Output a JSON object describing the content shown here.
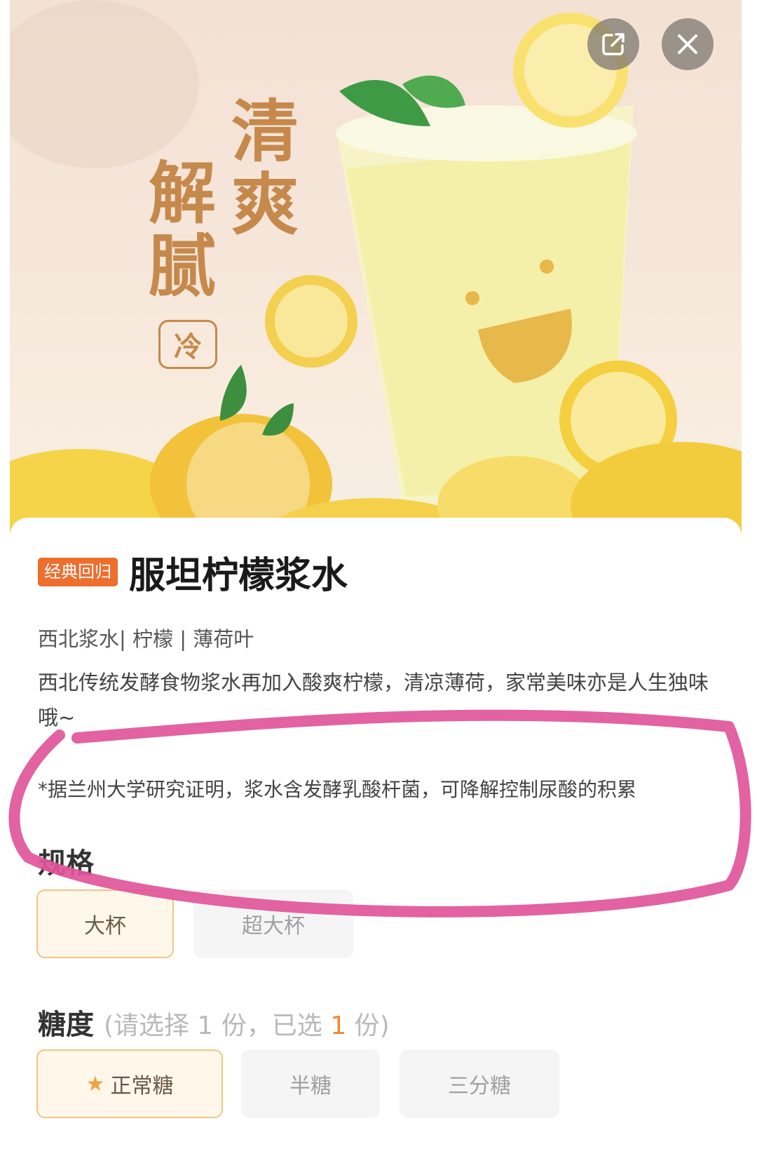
{
  "hero": {
    "slogan_col1": [
      "清",
      "爽"
    ],
    "slogan_col2": [
      "解",
      "腻"
    ],
    "cold_tag": "冷"
  },
  "actions": {
    "share_icon": "share-icon",
    "close_icon": "close-icon"
  },
  "product": {
    "badge": "经典回归",
    "name": "服坦柠檬浆水",
    "tags": "西北浆水| 柠檬 | 薄荷叶",
    "description": "西北传统发酵食物浆水再加入酸爽柠檬，清凉薄荷，家常美味亦是人生独味哦~",
    "note": "*据兰州大学研究证明，浆水含发酵乳酸杆菌，可降解控制尿酸的积累"
  },
  "spec": {
    "title": "规格",
    "options": [
      "大杯",
      "超大杯"
    ]
  },
  "sugar": {
    "title": "糖度",
    "hint_pre": "(请选择 1 份，已选 ",
    "hint_count": "1",
    "hint_post": " 份)",
    "options": [
      "正常糖",
      "半糖",
      "三分糖"
    ]
  },
  "colors": {
    "accent": "#ee6e2e",
    "slogan": "#c6894c",
    "annotation": "#e0559a"
  }
}
